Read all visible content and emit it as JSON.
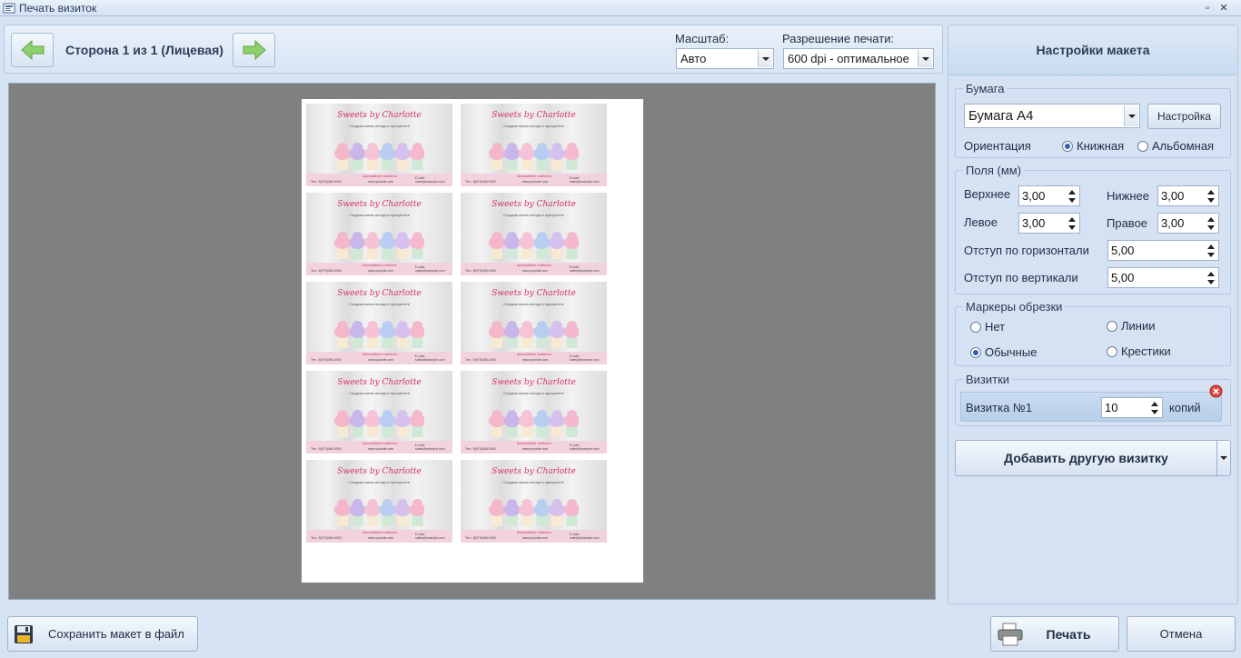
{
  "window": {
    "title": "Печать визиток"
  },
  "toolbar": {
    "side_label": "Сторона 1 из 1 (Лицевая)",
    "scale_label": "Масштаб:",
    "scale_value": "Авто",
    "resolution_label": "Разрешение печати:",
    "resolution_value": "600 dpi - оптимальное"
  },
  "preview": {
    "card": {
      "title": "Sweets by Charlotte",
      "subtitle": "Сладкая жизнь всегда в приоритете",
      "slogan": "Шоколадные сладости",
      "phone": "Тел.: 8(973)456-0000",
      "site": "www.yoursite.com",
      "email": "E-mail: sales@example.com"
    }
  },
  "panel": {
    "header": "Настройки макета",
    "paper": {
      "group_title": "Бумага",
      "value": "Бумага A4",
      "settings_button": "Настройка",
      "orientation_label": "Ориентация",
      "portrait": "Книжная",
      "landscape": "Альбомная",
      "selected": "portrait"
    },
    "margins": {
      "group_title": "Поля (мм)",
      "top_label": "Верхнее",
      "top_value": "3,00",
      "bottom_label": "Нижнее",
      "bottom_value": "3,00",
      "left_label": "Левое",
      "left_value": "3,00",
      "right_label": "Правое",
      "right_value": "3,00",
      "hspace_label": "Отступ по горизонтали",
      "hspace_value": "5,00",
      "vspace_label": "Отступ по вертикали",
      "vspace_value": "5,00"
    },
    "crop_marks": {
      "group_title": "Маркеры обрезки",
      "none": "Нет",
      "lines": "Линии",
      "normal": "Обычные",
      "crosses": "Крестики",
      "selected": "normal"
    },
    "cards": {
      "group_title": "Визитки",
      "item_label": "Визитка №1",
      "copies_value": "10",
      "copies_label": "копий",
      "add_button": "Добавить другую визитку"
    }
  },
  "bottom": {
    "save_button": "Сохранить макет в файл",
    "print_button": "Печать",
    "cancel_button": "Отмена"
  },
  "colors": {
    "background": "#d6e3f3",
    "preview_background": "#808080",
    "accent_pink": "#d8306c",
    "arrow_green": "#7fc65a"
  }
}
